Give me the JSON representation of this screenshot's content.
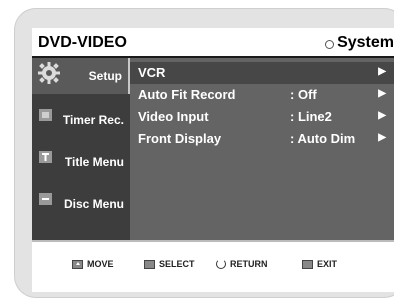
{
  "header": {
    "title": "DVD-VIDEO",
    "section": "System"
  },
  "sidebar": {
    "items": [
      {
        "label": "Setup",
        "icon": "gear-icon",
        "active": true
      },
      {
        "label": "Timer Rec.",
        "icon": "timer-icon",
        "active": false
      },
      {
        "label": "Title Menu",
        "icon": "title-icon",
        "active": false
      },
      {
        "label": "Disc Menu",
        "icon": "disc-icon",
        "active": false
      }
    ]
  },
  "menu": {
    "rows": [
      {
        "label": "VCR",
        "value": "",
        "arrow": "▶"
      },
      {
        "label": "Auto Fit Record",
        "value": ": Off",
        "arrow": "▶"
      },
      {
        "label": "Video Input",
        "value": ": Line2",
        "arrow": "▶"
      },
      {
        "label": "Front Display",
        "value": ": Auto Dim",
        "arrow": "▶"
      }
    ]
  },
  "footer": {
    "move": "MOVE",
    "select": "SELECT",
    "return": "RETURN",
    "exit": "EXIT"
  },
  "colors": {
    "sidebar_bg": "#3d3d3d",
    "main_bg": "#646464",
    "highlight_bg": "#474747"
  }
}
